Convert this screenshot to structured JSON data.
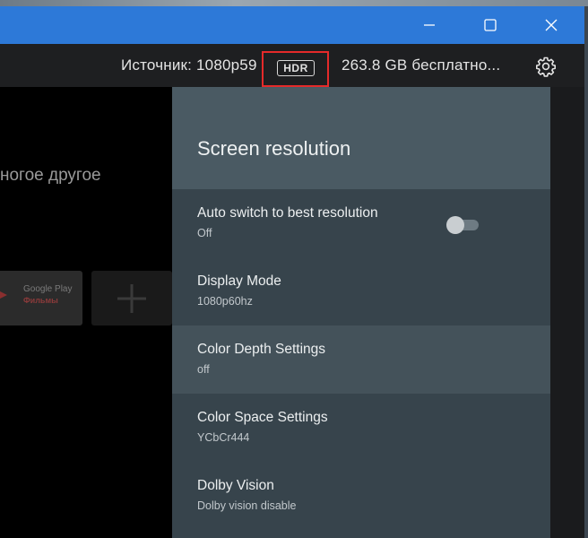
{
  "info_bar": {
    "source_text": "Источник: 1080p59",
    "hdr_badge": "HDR",
    "storage_text": "263.8 GB бесплатно..."
  },
  "background_tv": {
    "partial_text": "ногое другое",
    "tile_title": "Google Play",
    "tile_subtitle": "Фильмы",
    "add_symbol": "+"
  },
  "panel": {
    "title": "Screen resolution",
    "settings": [
      {
        "title": "Auto switch to best resolution",
        "value": "Off",
        "toggle_on": false
      },
      {
        "title": "Display Mode",
        "value": "1080p60hz"
      },
      {
        "title": "Color Depth Settings",
        "value": "off",
        "highlighted": true
      },
      {
        "title": "Color Space Settings",
        "value": "YCbCr444"
      },
      {
        "title": "Dolby Vision",
        "value": "Dolby vision disable"
      }
    ]
  },
  "colors": {
    "titlebar": "#2d79d8",
    "highlight_box": "#e52a2a",
    "panel_background": "#37444c"
  },
  "icons": [
    "minimize-icon",
    "maximize-icon",
    "close-icon",
    "gear-icon",
    "google-play-icon",
    "plus-icon"
  ]
}
